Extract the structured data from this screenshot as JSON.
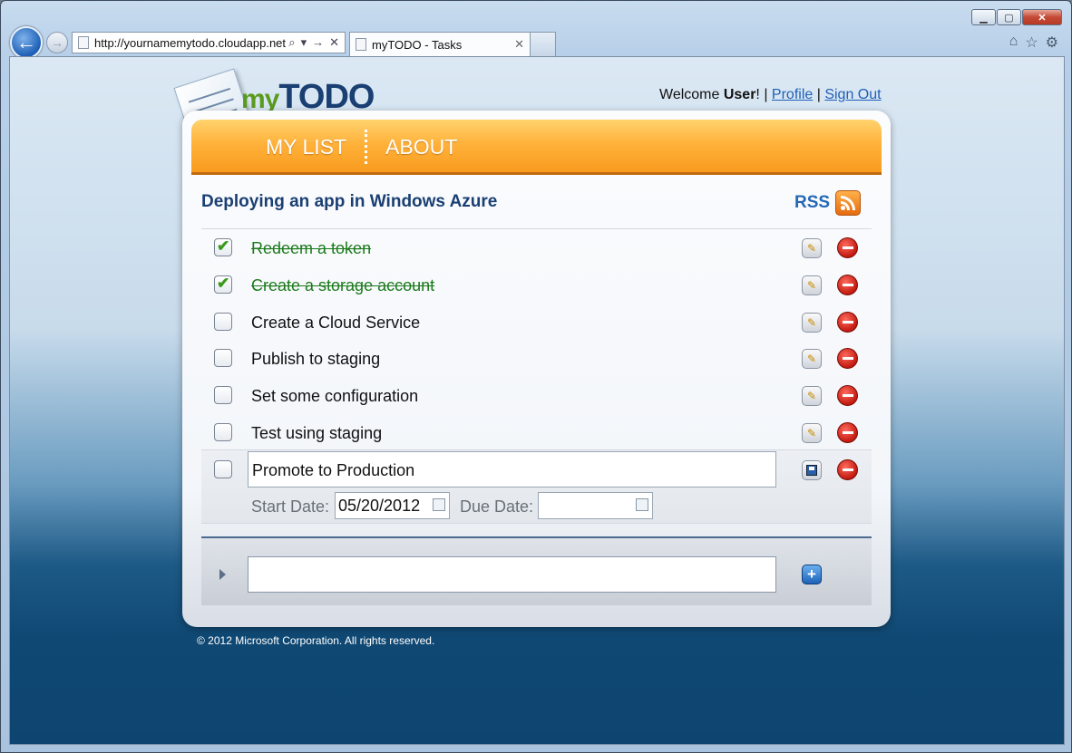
{
  "browser": {
    "url": "http://yournamemytodo.cloudapp.net",
    "tab_title": "myTODO - Tasks",
    "tab_close": "✕",
    "window_controls": [
      "minimize",
      "maximize",
      "close"
    ]
  },
  "header": {
    "logo_my": "my",
    "logo_todo": "TODO",
    "welcome_prefix": "Welcome ",
    "user": "User",
    "welcome_suffix": "! | ",
    "profile_link": "Profile",
    "sep": " | ",
    "signout_link": "Sign Out"
  },
  "menu": {
    "items": [
      "MY LIST",
      "ABOUT"
    ]
  },
  "list": {
    "title": "Deploying an app in Windows Azure",
    "rss_label": "RSS",
    "tasks": [
      {
        "text": "Redeem a token",
        "done": true
      },
      {
        "text": "Create a storage account",
        "done": true
      },
      {
        "text": "Create a Cloud Service",
        "done": false
      },
      {
        "text": "Publish to staging",
        "done": false
      },
      {
        "text": "Set some configuration",
        "done": false
      },
      {
        "text": "Test using staging",
        "done": false
      }
    ],
    "editing": {
      "text": "Promote to Production",
      "start_label": "Start Date:",
      "start_value": "05/20/2012",
      "due_label": "Due Date:",
      "due_value": ""
    },
    "new_task_value": ""
  },
  "footer": {
    "copyright": "© 2012 Microsoft Corporation. All rights reserved."
  },
  "colors": {
    "accent_orange": "#ffb13a",
    "title_blue": "#1a3f72",
    "done_green": "#1c7a1c",
    "delete_red": "#c31a10"
  }
}
